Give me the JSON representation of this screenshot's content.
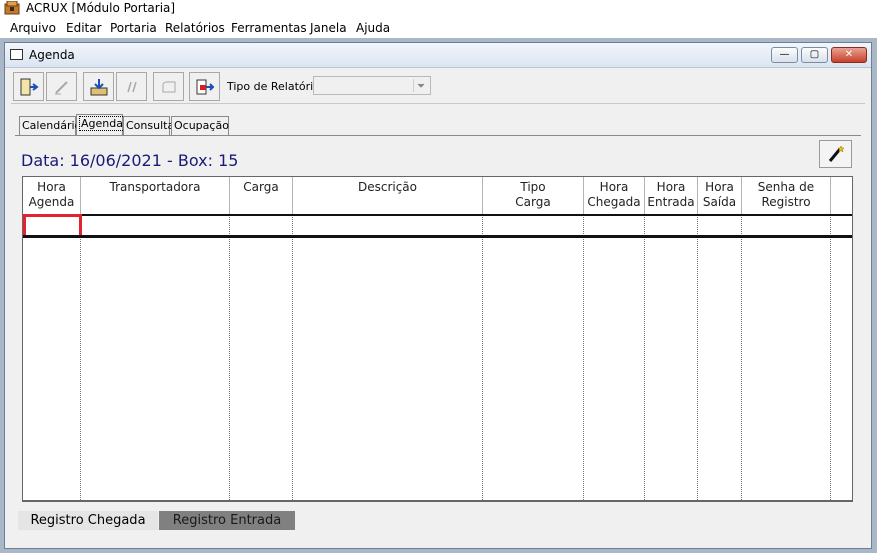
{
  "app": {
    "title": "ACRUX [Módulo Portaria]"
  },
  "menu": [
    "Arquivo",
    "Editar",
    "Portaria",
    "Relatórios",
    "Ferramentas",
    "Janela",
    "Ajuda"
  ],
  "window": {
    "title": "Agenda",
    "buttons": {
      "minimize": "—",
      "restore": "▢",
      "close": "✕"
    }
  },
  "toolbar": {
    "buttons": [
      "exit-icon",
      "edit-icon",
      "save-download-icon",
      "undo-icon",
      "redo-icon",
      "export-icon"
    ],
    "tipo_label": "Tipo de Relatório",
    "tipo_value": ""
  },
  "tabs": [
    {
      "label": "Calendário",
      "active": false
    },
    {
      "label": "Agenda",
      "active": true
    },
    {
      "label": "Consulta",
      "active": false
    },
    {
      "label": "Ocupação",
      "active": false
    }
  ],
  "agenda": {
    "title": "Data: 16/06/2021 - Box: 15"
  },
  "grid": {
    "columns": [
      [
        "Hora",
        "Agenda"
      ],
      [
        "Transportadora",
        ""
      ],
      [
        "Carga",
        ""
      ],
      [
        "Descrição",
        ""
      ],
      [
        "Tipo",
        "Carga"
      ],
      [
        "Hora",
        "Chegada"
      ],
      [
        "Hora",
        "Entrada"
      ],
      [
        "Hora",
        "Saída"
      ],
      [
        "Senha de",
        "Registro"
      ]
    ],
    "rows": [
      [
        "",
        "",
        "",
        "",
        "",
        "",
        "",
        "",
        ""
      ]
    ]
  },
  "status_buttons": {
    "chegada": "Registro Chegada",
    "entrada": "Registro Entrada"
  },
  "colors": {
    "title_text": "#1a1a7a",
    "active_cell_border": "#e3232e",
    "mdi_background": "#aab7c7"
  }
}
